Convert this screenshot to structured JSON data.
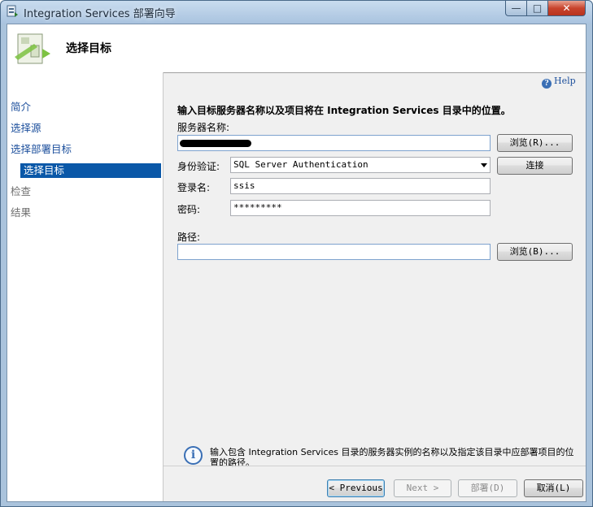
{
  "window": {
    "title": "Integration Services 部署向导",
    "controls": {
      "minimize": "—",
      "maximize": "□",
      "close": "✕"
    }
  },
  "header": {
    "title": "选择目标"
  },
  "sidebar": {
    "items": [
      {
        "label": "简介"
      },
      {
        "label": "选择源"
      },
      {
        "label": "选择部署目标"
      },
      {
        "label": "选择目标"
      },
      {
        "label": "检查"
      },
      {
        "label": "结果"
      }
    ]
  },
  "main": {
    "help_label": "Help",
    "instruction": "输入目标服务器名称以及项目将在 Integration Services 目录中的位置。",
    "server": {
      "label": "服务器名称:",
      "value": "",
      "browse_label": "浏览(R)..."
    },
    "auth": {
      "label": "身份验证:",
      "value": "SQL Server Authentication",
      "connect_label": "连接"
    },
    "login": {
      "label": "登录名:",
      "value": "ssis"
    },
    "password": {
      "label": "密码:",
      "value": "*********"
    },
    "path": {
      "label": "路径:",
      "value": "",
      "browse_label": "浏览(B)..."
    },
    "info_text": "输入包含 Integration Services 目录的服务器实例的名称以及指定该目录中应部署项目的位置的路径。"
  },
  "footer": {
    "previous_label": "< Previous",
    "next_label": "Next >",
    "deploy_label": "部署(D)",
    "cancel_label": "取消(L)"
  },
  "colors": {
    "accent": "#0a58a8",
    "link": "#1c4f9c",
    "titlebar": "#aac3dc",
    "close": "#c8442d"
  },
  "icons": [
    "app-icon",
    "wizard-header-icon",
    "help-icon",
    "info-icon",
    "chevron-down-icon"
  ]
}
